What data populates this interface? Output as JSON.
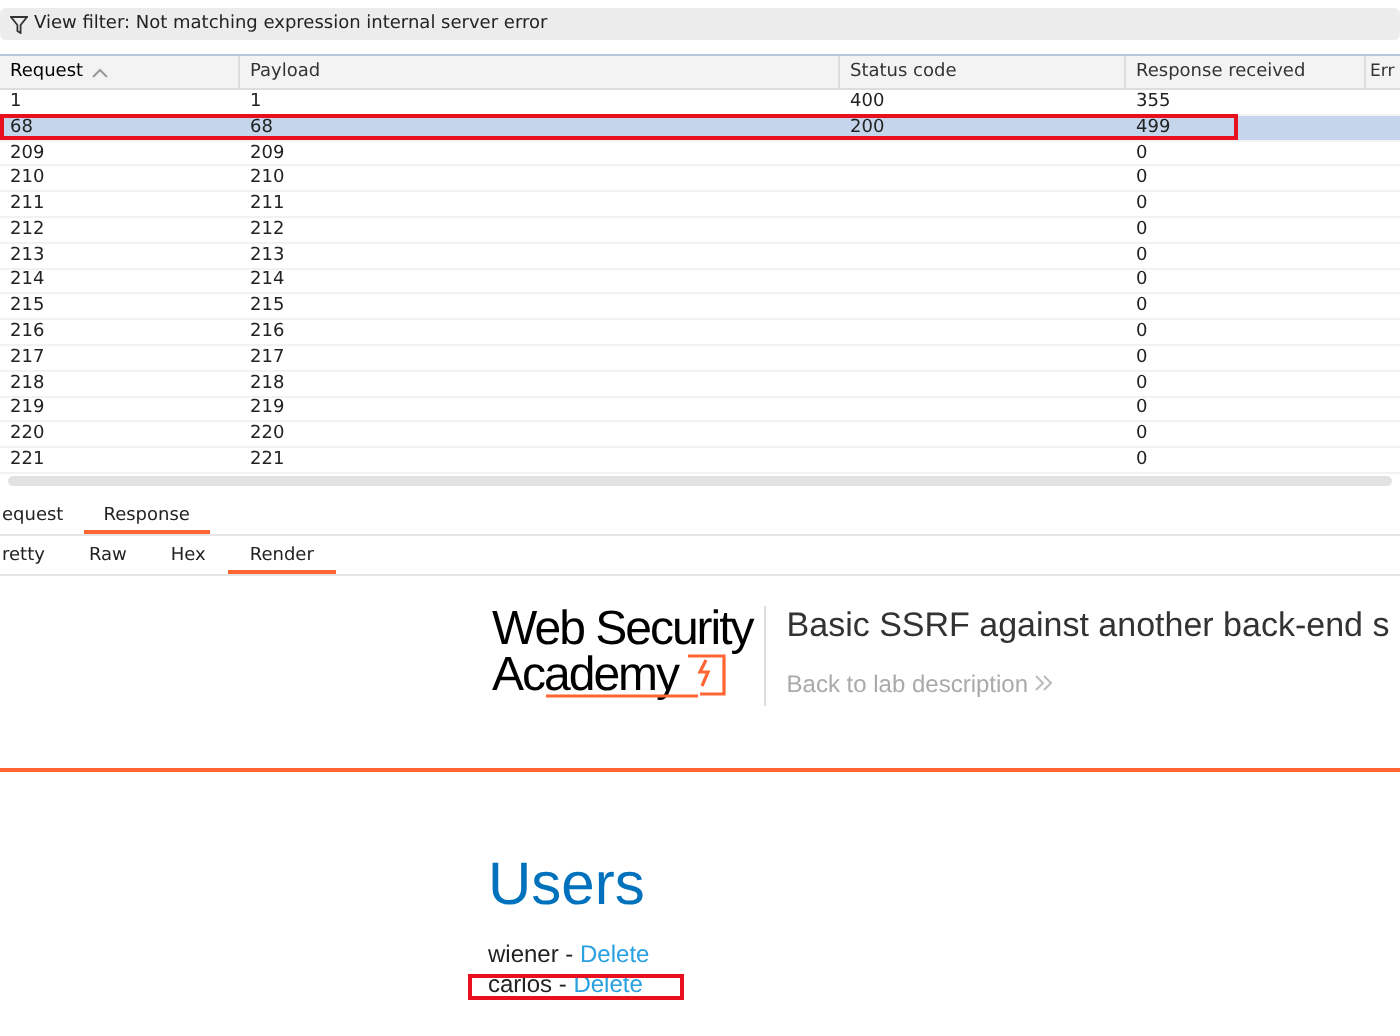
{
  "filter_bar": {
    "text": "View filter: Not matching expression internal server error"
  },
  "table": {
    "columns": [
      {
        "label": "Request",
        "sorted": true
      },
      {
        "label": "Payload",
        "sorted": false
      },
      {
        "label": "Status code",
        "sorted": false
      },
      {
        "label": "Response received",
        "sorted": false
      },
      {
        "label": "Err",
        "sorted": false
      }
    ],
    "rows": [
      {
        "cells": [
          "1",
          "1",
          "400",
          "355"
        ],
        "selected": false,
        "annotated": false
      },
      {
        "cells": [
          "68",
          "68",
          "200",
          "499"
        ],
        "selected": true,
        "annotated": true
      },
      {
        "cells": [
          "209",
          "209",
          "",
          "0"
        ],
        "selected": false,
        "annotated": false
      },
      {
        "cells": [
          "210",
          "210",
          "",
          "0"
        ],
        "selected": false,
        "annotated": false
      },
      {
        "cells": [
          "211",
          "211",
          "",
          "0"
        ],
        "selected": false,
        "annotated": false
      },
      {
        "cells": [
          "212",
          "212",
          "",
          "0"
        ],
        "selected": false,
        "annotated": false
      },
      {
        "cells": [
          "213",
          "213",
          "",
          "0"
        ],
        "selected": false,
        "annotated": false
      },
      {
        "cells": [
          "214",
          "214",
          "",
          "0"
        ],
        "selected": false,
        "annotated": false
      },
      {
        "cells": [
          "215",
          "215",
          "",
          "0"
        ],
        "selected": false,
        "annotated": false
      },
      {
        "cells": [
          "216",
          "216",
          "",
          "0"
        ],
        "selected": false,
        "annotated": false
      },
      {
        "cells": [
          "217",
          "217",
          "",
          "0"
        ],
        "selected": false,
        "annotated": false
      },
      {
        "cells": [
          "218",
          "218",
          "",
          "0"
        ],
        "selected": false,
        "annotated": false
      },
      {
        "cells": [
          "219",
          "219",
          "",
          "0"
        ],
        "selected": false,
        "annotated": false
      },
      {
        "cells": [
          "220",
          "220",
          "",
          "0"
        ],
        "selected": false,
        "annotated": false
      },
      {
        "cells": [
          "221",
          "221",
          "",
          "0"
        ],
        "selected": false,
        "annotated": false
      }
    ]
  },
  "tabs": [
    {
      "label": "equest",
      "selected": false
    },
    {
      "label": "Response",
      "selected": true
    }
  ],
  "view_tabs": [
    {
      "label": "retty",
      "selected": false
    },
    {
      "label": "Raw",
      "selected": false
    },
    {
      "label": "Hex",
      "selected": false
    },
    {
      "label": "Render",
      "selected": true
    }
  ],
  "render": {
    "logo": [
      "Web Security",
      "Academy"
    ],
    "title": "Basic SSRF against another back-end s",
    "back_link": "Back to lab description",
    "heading": "Users",
    "users": [
      {
        "name": "wiener",
        "separator": " - ",
        "action": "Delete",
        "annotated": false
      },
      {
        "name": "carlos",
        "separator": " - ",
        "action": "Delete",
        "annotated": true
      }
    ]
  }
}
